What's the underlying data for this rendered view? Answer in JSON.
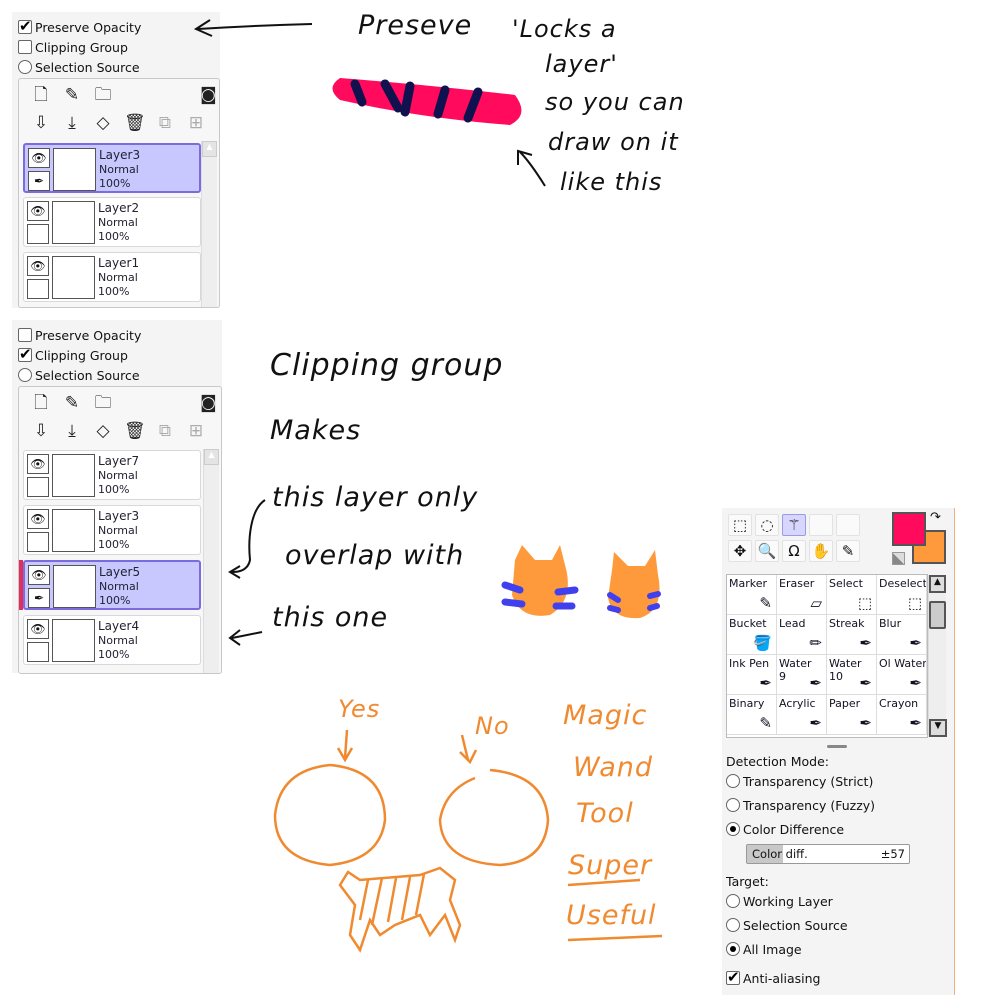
{
  "panel1": {
    "options": [
      {
        "label": "Preserve Opacity",
        "type": "checkbox",
        "checked": true
      },
      {
        "label": "Clipping Group",
        "type": "checkbox",
        "checked": false
      },
      {
        "label": "Selection Source",
        "type": "radio",
        "checked": false
      }
    ],
    "layers": [
      {
        "name": "Layer3",
        "mode": "Normal",
        "opacity": "100%",
        "selected": true
      },
      {
        "name": "Layer2",
        "mode": "Normal",
        "opacity": "100%",
        "selected": false
      },
      {
        "name": "Layer1",
        "mode": "Normal",
        "opacity": "100%",
        "selected": false
      }
    ]
  },
  "panel2": {
    "options": [
      {
        "label": "Preserve Opacity",
        "type": "checkbox",
        "checked": false
      },
      {
        "label": "Clipping Group",
        "type": "checkbox",
        "checked": true
      },
      {
        "label": "Selection Source",
        "type": "radio",
        "checked": false
      }
    ],
    "layers": [
      {
        "name": "Layer7",
        "mode": "Normal",
        "opacity": "100%",
        "selected": false
      },
      {
        "name": "Layer3",
        "mode": "Normal",
        "opacity": "100%",
        "selected": false
      },
      {
        "name": "Layer5",
        "mode": "Normal",
        "opacity": "100%",
        "selected": true,
        "clipped": true
      },
      {
        "name": "Layer4",
        "mode": "Normal",
        "opacity": "100%",
        "selected": false
      }
    ]
  },
  "layer_icons": [
    "new-layer-icon",
    "new-linework-layer-icon",
    "new-folder-icon",
    "mask-icon",
    "transfer-down-icon",
    "merge-down-icon",
    "clear-layer-icon",
    "delete-layer-icon",
    "transfer-mask-icon",
    "merge-mask-icon"
  ],
  "notes": {
    "preserve": [
      "Preseve",
      "'Locks a",
      "layer'",
      "so you can",
      "draw on it",
      "like this"
    ],
    "clipping": [
      "Clipping group",
      "Makes",
      "this layer only",
      "overlap with",
      "this one"
    ],
    "wand": {
      "yes": "Yes",
      "no": "No",
      "title": [
        "Magic",
        "Wand",
        "Tool"
      ],
      "super": [
        "Super",
        "Useful"
      ]
    }
  },
  "colors": {
    "primary": "#ff0a5c",
    "secondary": "#ff9a3c",
    "stroke": "#f08a30",
    "stripe": "#111150",
    "clip_bar": "#e0305a",
    "selected_layer": "#c8c8ff"
  },
  "tools": {
    "icons": [
      "rect-select-icon",
      "lasso-icon",
      "magic-wand-icon",
      "move-icon",
      "zoom-icon",
      "rotate-icon",
      "hand-icon",
      "eyedropper-icon"
    ],
    "brushes": [
      {
        "label": "Marker"
      },
      {
        "label": "Eraser"
      },
      {
        "label": "Select"
      },
      {
        "label": "Deselect"
      },
      {
        "label": "Bucket"
      },
      {
        "label": "Lead"
      },
      {
        "label": "Streak"
      },
      {
        "label": "Blur"
      },
      {
        "label": "Ink Pen"
      },
      {
        "label": "Water",
        "sub": "9"
      },
      {
        "label": "Water",
        "sub": "10"
      },
      {
        "label": "Ol Water"
      },
      {
        "label": "Binary"
      },
      {
        "label": "Acrylic"
      },
      {
        "label": "Paper"
      },
      {
        "label": "Crayon"
      }
    ],
    "detection_mode_label": "Detection Mode:",
    "detection_modes": [
      {
        "label": "Transparency (Strict)",
        "checked": false
      },
      {
        "label": "Transparency (Fuzzy)",
        "checked": false
      },
      {
        "label": "Color Difference",
        "checked": true
      }
    ],
    "color_diff": {
      "label": "Color diff.",
      "value": "±57",
      "fill_percent": 22
    },
    "target_label": "Target:",
    "targets": [
      {
        "label": "Working Layer",
        "checked": false
      },
      {
        "label": "Selection Source",
        "checked": false
      },
      {
        "label": "All Image",
        "checked": true
      }
    ],
    "anti_aliasing": {
      "label": "Anti-aliasing",
      "checked": true
    }
  }
}
